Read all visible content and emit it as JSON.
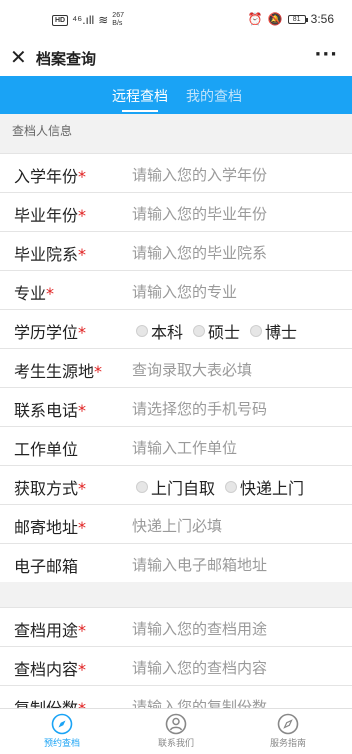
{
  "status": {
    "network": "267",
    "network_unit": "B/s",
    "battery": "81",
    "time": "3:56"
  },
  "header": {
    "title": "档案查询"
  },
  "tabs": [
    {
      "label": "远程查档"
    },
    {
      "label": "我的查档"
    }
  ],
  "section1": {
    "label": "查档人信息"
  },
  "form": {
    "enroll_year": {
      "label": "入学年份",
      "placeholder": "请输入您的入学年份"
    },
    "grad_year": {
      "label": "毕业年份",
      "placeholder": "请输入您的毕业年份"
    },
    "grad_dept": {
      "label": "毕业院系",
      "placeholder": "请输入您的毕业院系"
    },
    "major": {
      "label": "专业",
      "placeholder": "请输入您的专业"
    },
    "degree": {
      "label": "学历学位",
      "options": [
        "本科",
        "硕士",
        "博士"
      ]
    },
    "origin": {
      "label": "考生生源地",
      "placeholder": "查询录取大表必填"
    },
    "phone": {
      "label": "联系电话",
      "placeholder": "请选择您的手机号码"
    },
    "work": {
      "label": "工作单位",
      "placeholder": "请输入工作单位"
    },
    "method": {
      "label": "获取方式",
      "options": [
        "上门自取",
        "快递上门"
      ]
    },
    "address": {
      "label": "邮寄地址",
      "placeholder": "快递上门必填"
    },
    "email": {
      "label": "电子邮箱",
      "placeholder": "请输入电子邮箱地址"
    },
    "purpose": {
      "label": "查档用途",
      "placeholder": "请输入您的查档用途"
    },
    "content": {
      "label": "查档内容",
      "placeholder": "请输入您的查档内容"
    },
    "copies": {
      "label": "复制份数",
      "placeholder": "请输入您的复制份数"
    }
  },
  "required_mark": "*",
  "bottom_nav": [
    {
      "label": "预约查档",
      "icon": "compass-icon"
    },
    {
      "label": "联系我们",
      "icon": "user-icon"
    },
    {
      "label": "服务指南",
      "icon": "compass-icon"
    }
  ],
  "colors": {
    "accent": "#1aa3f5",
    "required": "#e02020"
  }
}
